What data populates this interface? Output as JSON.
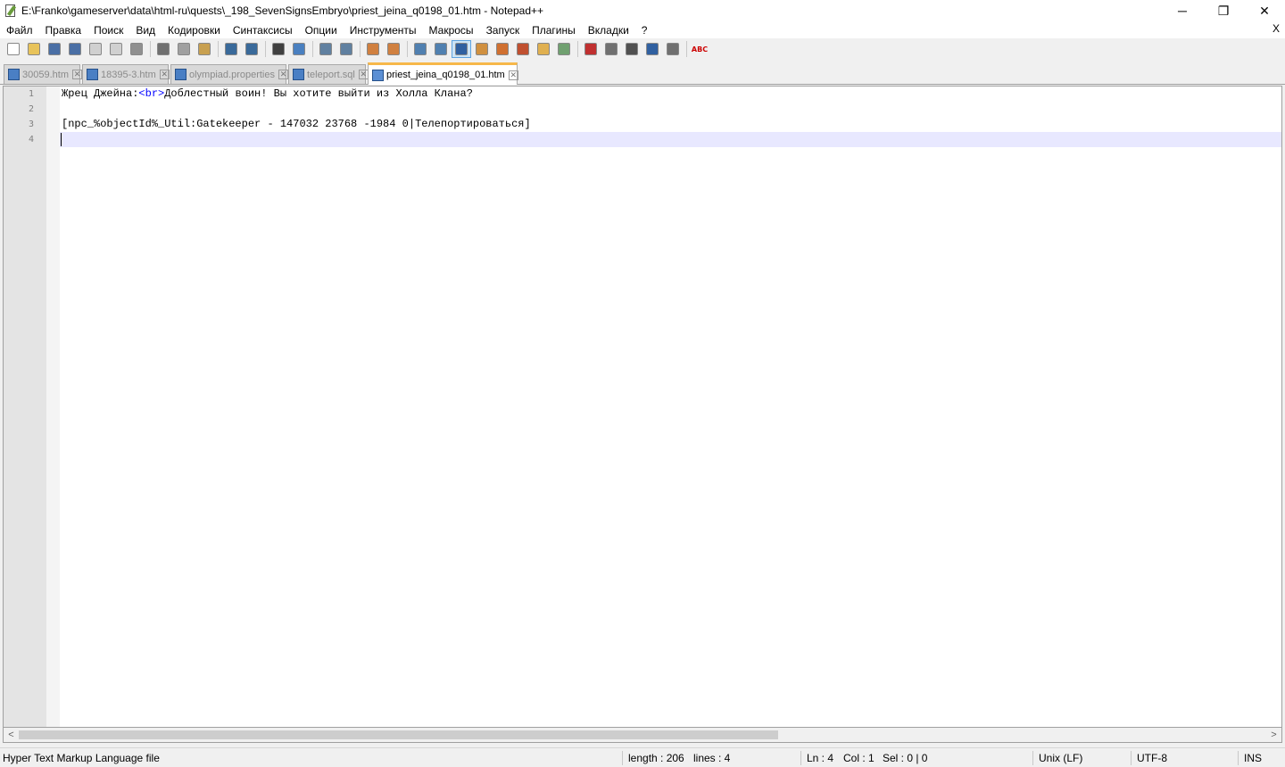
{
  "window": {
    "title": "E:\\Franko\\gameserver\\data\\html-ru\\quests\\_198_SevenSignsEmbryo\\priest_jeina_q0198_01.htm - Notepad++",
    "minimize": "─",
    "restore": "❐",
    "close": "✕"
  },
  "menu": {
    "items": [
      "Файл",
      "Правка",
      "Поиск",
      "Вид",
      "Кодировки",
      "Синтаксисы",
      "Опции",
      "Инструменты",
      "Макросы",
      "Запуск",
      "Плагины",
      "Вкладки",
      "?"
    ],
    "close_doc": "X"
  },
  "toolbar": {
    "buttons": [
      {
        "name": "new-file",
        "color": "#ffffff"
      },
      {
        "name": "open-file",
        "color": "#e8c35a"
      },
      {
        "name": "save",
        "color": "#4a6fa5"
      },
      {
        "name": "save-all",
        "color": "#4a6fa5"
      },
      {
        "name": "close",
        "color": "#d0d0d0"
      },
      {
        "name": "close-all",
        "color": "#d0d0d0"
      },
      {
        "name": "print",
        "color": "#909090"
      },
      {
        "name": "cut",
        "color": "#707070"
      },
      {
        "name": "copy",
        "color": "#a0a0a0"
      },
      {
        "name": "paste",
        "color": "#c8a050"
      },
      {
        "name": "undo",
        "color": "#3a6a9a"
      },
      {
        "name": "redo",
        "color": "#3a6a9a"
      },
      {
        "name": "find",
        "color": "#404040"
      },
      {
        "name": "replace",
        "color": "#4a80c0"
      },
      {
        "name": "zoom-in",
        "color": "#6080a0"
      },
      {
        "name": "zoom-out",
        "color": "#6080a0"
      },
      {
        "name": "sync-vertical",
        "color": "#d08040"
      },
      {
        "name": "sync-horizontal",
        "color": "#d08040"
      },
      {
        "name": "word-wrap",
        "color": "#5080b0"
      },
      {
        "name": "show-all-chars",
        "color": "#5080b0"
      },
      {
        "name": "indent-guide",
        "color": "#3060a0",
        "active": true
      },
      {
        "name": "udl",
        "color": "#d09040"
      },
      {
        "name": "doc-map",
        "color": "#d07030"
      },
      {
        "name": "function-list",
        "color": "#c05030"
      },
      {
        "name": "folder-workspace",
        "color": "#e0b050"
      },
      {
        "name": "monitoring",
        "color": "#70a070"
      },
      {
        "name": "macro-record",
        "color": "#c03030"
      },
      {
        "name": "macro-stop",
        "color": "#707070"
      },
      {
        "name": "macro-play",
        "color": "#505050"
      },
      {
        "name": "macro-play-multi",
        "color": "#3060a0"
      },
      {
        "name": "macro-save",
        "color": "#707070"
      },
      {
        "name": "spellcheck",
        "label": "ABC"
      }
    ]
  },
  "tabs": [
    {
      "label": "30059.htm",
      "active": false
    },
    {
      "label": "18395-3.htm",
      "active": false
    },
    {
      "label": "olympiad.properties",
      "active": false
    },
    {
      "label": "teleport.sql",
      "active": false
    },
    {
      "label": "priest_jeina_q0198_01.htm",
      "active": true
    }
  ],
  "tab_close": "✕",
  "editor": {
    "line_numbers": [
      "1",
      "2",
      "3",
      "4"
    ],
    "line1_a": "Жрец Джейна:",
    "line1_tag": "<br>",
    "line1_b": "Доблестный воин! Вы хотите выйти из Холла Клана?",
    "line2": "",
    "line3": "[npc_%objectId%_Util:Gatekeeper - 147032 23768 -1984 0|Телепортироваться]",
    "line4": ""
  },
  "scrollbar": {
    "left_arrow": "<",
    "right_arrow": ">"
  },
  "status": {
    "file_type": "Hyper Text Markup Language file",
    "length": "length : 206",
    "lines": "lines : 4",
    "ln": "Ln : 4",
    "col": "Col : 1",
    "sel": "Sel : 0 | 0",
    "eol": "Unix (LF)",
    "encoding": "UTF-8",
    "mode": "INS"
  }
}
